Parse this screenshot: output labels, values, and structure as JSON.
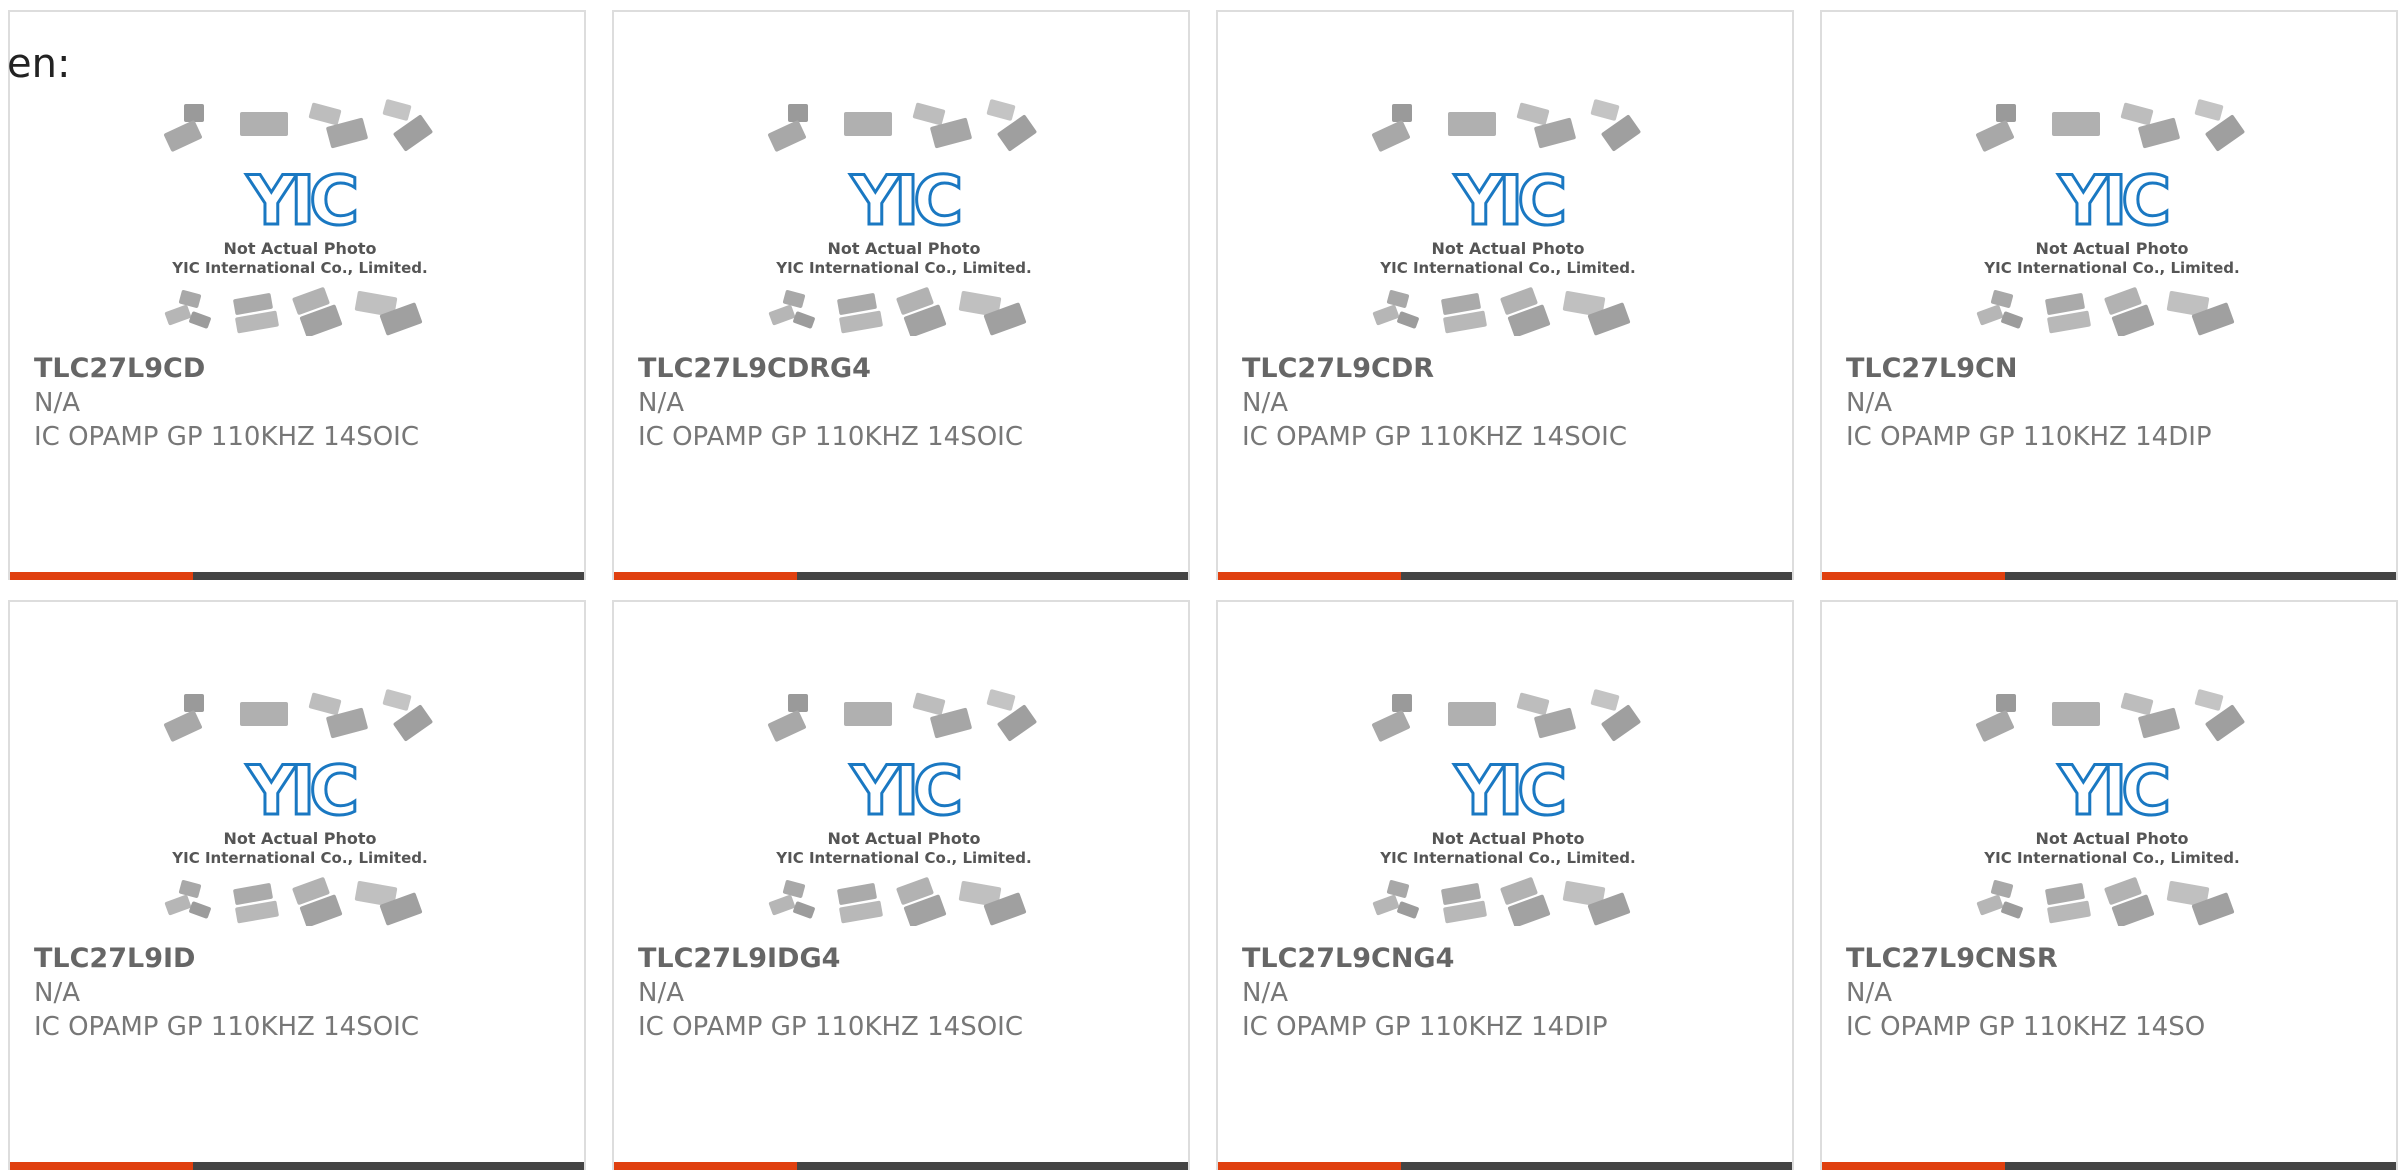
{
  "page": {
    "lang_label": "en:"
  },
  "placeholder": {
    "logo_text": "YIC",
    "line1": "Not Actual Photo",
    "line2": "YIC International Co., Limited."
  },
  "colors": {
    "accent": "#e0400f",
    "bar_dark": "#444444",
    "logo_blue": "#1a78c2",
    "text_gray": "#666666"
  },
  "products": [
    {
      "part": "TLC27L9CD",
      "manufacturer": "N/A",
      "description": "IC OPAMP GP 110KHZ 14SOIC"
    },
    {
      "part": "TLC27L9CDRG4",
      "manufacturer": "N/A",
      "description": "IC OPAMP GP 110KHZ 14SOIC"
    },
    {
      "part": "TLC27L9CDR",
      "manufacturer": "N/A",
      "description": "IC OPAMP GP 110KHZ 14SOIC"
    },
    {
      "part": "TLC27L9CN",
      "manufacturer": "N/A",
      "description": "IC OPAMP GP 110KHZ 14DIP"
    },
    {
      "part": "TLC27L9ID",
      "manufacturer": "N/A",
      "description": "IC OPAMP GP 110KHZ 14SOIC"
    },
    {
      "part": "TLC27L9IDG4",
      "manufacturer": "N/A",
      "description": "IC OPAMP GP 110KHZ 14SOIC"
    },
    {
      "part": "TLC27L9CNG4",
      "manufacturer": "N/A",
      "description": "IC OPAMP GP 110KHZ 14DIP"
    },
    {
      "part": "TLC27L9CNSR",
      "manufacturer": "N/A",
      "description": "IC OPAMP GP 110KHZ 14SO"
    }
  ]
}
